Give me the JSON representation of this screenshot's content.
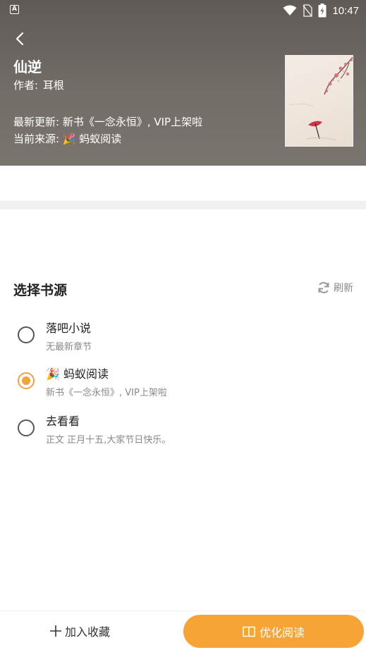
{
  "status_bar": {
    "time": "10:47",
    "app_icon_letter": "A"
  },
  "book": {
    "title": "仙逆",
    "author_label": "作者:",
    "author": "耳根",
    "latest_update": "最新更新: 新书《一念永恒》, VIP上架啦",
    "current_source": "当前来源: 🎉 蚂蚁阅读"
  },
  "source_section": {
    "title": "选择书源",
    "refresh_label": "刷新",
    "options": [
      {
        "name": "落吧小说",
        "subtitle": "无最新章节",
        "selected": false
      },
      {
        "name": "🎉 蚂蚁阅读",
        "subtitle": "新书《一念永恒》, VIP上架啦",
        "selected": true
      },
      {
        "name": "去看看",
        "subtitle": "正文 正月十五,大家节日快乐。",
        "selected": false
      }
    ]
  },
  "bottom_bar": {
    "add_favorite_label": "加入收藏",
    "read_label": "优化阅读"
  },
  "colors": {
    "accent": "#f7a437",
    "header_bg": "#6b6561"
  }
}
